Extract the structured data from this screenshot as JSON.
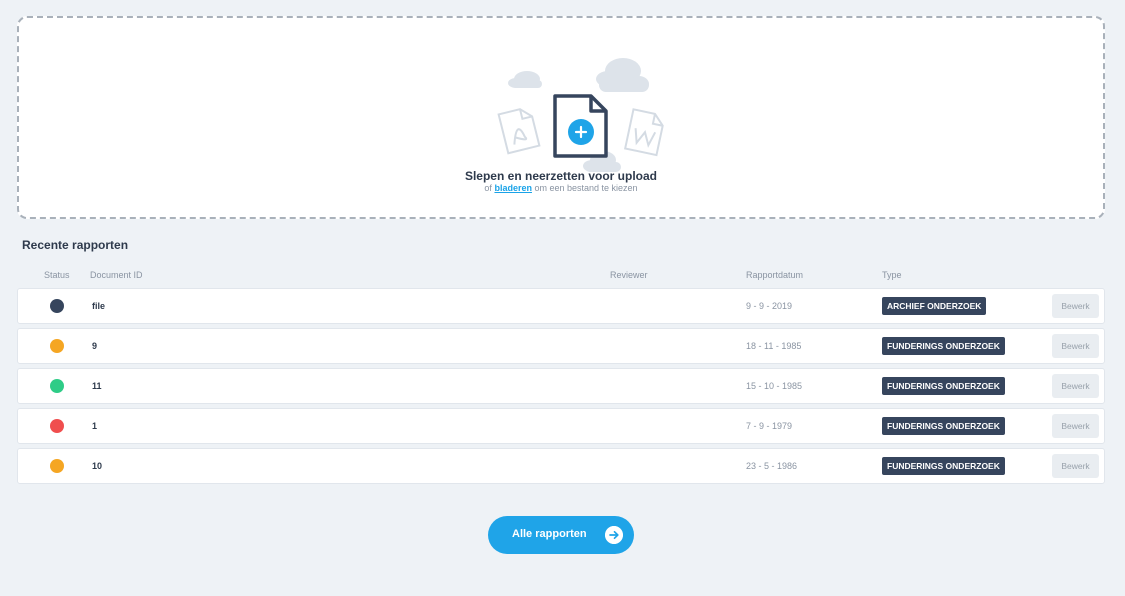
{
  "upload": {
    "title": "Slepen en neerzetten voor upload",
    "sub_prefix": "of",
    "browse_link": "bladeren",
    "sub_suffix": "om een bestand te kiezen"
  },
  "recent": {
    "title": "Recente rapporten",
    "columns": {
      "status": "Status",
      "document_id": "Document ID",
      "reviewer": "Reviewer",
      "date": "Rapportdatum",
      "type": "Type"
    },
    "rows": [
      {
        "status_color": "#36455d",
        "document_id": "file",
        "reviewer": "",
        "date": "9 - 9 - 2019",
        "type": "ARCHIEF ONDERZOEK",
        "edit_label": "Bewerk"
      },
      {
        "status_color": "#f5a623",
        "document_id": "9",
        "reviewer": "",
        "date": "18 - 11 - 1985",
        "type": "FUNDERINGS ONDERZOEK",
        "edit_label": "Bewerk"
      },
      {
        "status_color": "#2ecc87",
        "document_id": "11",
        "reviewer": "",
        "date": "15 - 10 - 1985",
        "type": "FUNDERINGS ONDERZOEK",
        "edit_label": "Bewerk"
      },
      {
        "status_color": "#f04e4e",
        "document_id": "1",
        "reviewer": "",
        "date": "7 - 9 - 1979",
        "type": "FUNDERINGS ONDERZOEK",
        "edit_label": "Bewerk"
      },
      {
        "status_color": "#f5a623",
        "document_id": "10",
        "reviewer": "",
        "date": "23 - 5 - 1986",
        "type": "FUNDERINGS ONDERZOEK",
        "edit_label": "Bewerk"
      }
    ]
  },
  "all_reports_button": {
    "label": "Alle rapporten",
    "icon": "arrow-right-icon"
  },
  "colors": {
    "accent": "#1fa4e8",
    "badge": "#36455d",
    "background": "#eef2f6"
  }
}
